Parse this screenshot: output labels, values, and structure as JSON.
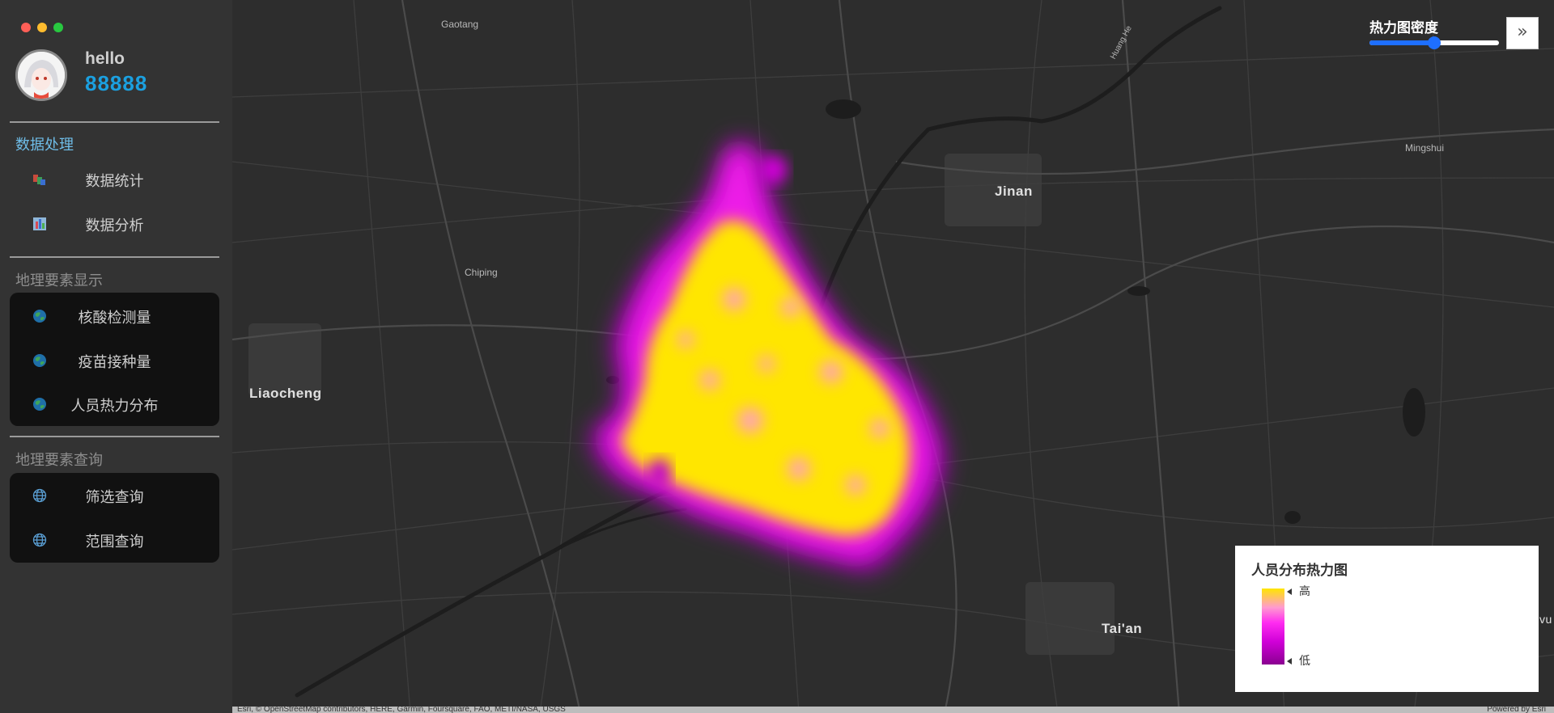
{
  "window": {
    "controls": [
      "close",
      "minimize",
      "maximize"
    ]
  },
  "user": {
    "name": "hello",
    "id": "88888"
  },
  "sidebar": {
    "sections": [
      {
        "title": "数据处理",
        "items": [
          {
            "label": "数据统计",
            "icon": "bar-chart-icon"
          },
          {
            "label": "数据分析",
            "icon": "analysis-chart-icon"
          }
        ]
      },
      {
        "title": "地理要素显示",
        "items": [
          {
            "label": "核酸检测量",
            "icon": "globe-icon"
          },
          {
            "label": "疫苗接种量",
            "icon": "globe-icon"
          },
          {
            "label": "人员热力分布",
            "icon": "globe-icon"
          }
        ]
      },
      {
        "title": "地理要素查询",
        "items": [
          {
            "label": "筛选查询",
            "icon": "web-globe-icon"
          },
          {
            "label": "范围查询",
            "icon": "web-globe-icon"
          }
        ]
      }
    ]
  },
  "map": {
    "places": {
      "gaotang": "Gaotang",
      "jinan": "Jinan",
      "mingshui": "Mingshui",
      "chiping": "Chiping",
      "liaocheng": "Liaocheng",
      "taian": "Tai'an",
      "huanghe": "Huang He",
      "edge": "vu"
    },
    "attribution_left": "Esri, © OpenStreetMap contributors, HERE, Garmin, Foursquare, FAO, METI/NASA, USGS",
    "attribution_right": "Powered by Esri"
  },
  "density_control": {
    "title": "热力图密度",
    "value": 0.5
  },
  "legend": {
    "title": "人员分布热力图",
    "high": "高",
    "low": "低"
  },
  "colors": {
    "accent": "#1e6fff",
    "heat_high": "#ffe600",
    "heat_mid": "#ff2cf0",
    "heat_low": "#8a0090",
    "sidebar_bg": "#333333"
  }
}
